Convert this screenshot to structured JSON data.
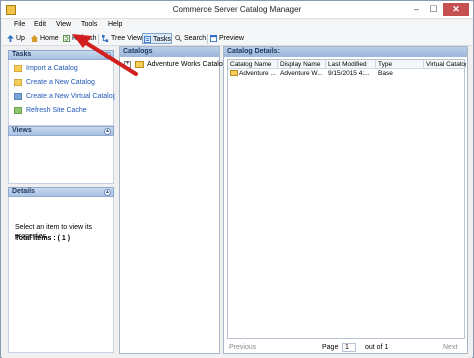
{
  "window": {
    "title": "Commerce Server Catalog Manager",
    "close_glyph": "✕",
    "min_glyph": "–",
    "max_glyph": "☐"
  },
  "menu": [
    "File",
    "Edit",
    "View",
    "Tools",
    "Help"
  ],
  "toolbar": {
    "up": "Up",
    "home": "Home",
    "refresh": "Refresh",
    "tree_view": "Tree View",
    "tasks": "Tasks",
    "search": "Search",
    "preview": "Preview"
  },
  "tasks_panel": {
    "title": "Tasks",
    "items": [
      "Import a Catalog",
      "Create a New Catalog",
      "Create a New Virtual Catalog",
      "Refresh Site Cache"
    ]
  },
  "views_panel": {
    "title": "Views"
  },
  "details_panel": {
    "title": "Details",
    "hint": "Select an item to view its properties",
    "total": "Total Items : ( 1 )"
  },
  "catalogs_pane": {
    "title": "Catalogs",
    "tree": [
      {
        "expander": "+",
        "label": "Adventure Works Catalog"
      }
    ]
  },
  "catalog_details": {
    "title": "Catalog Details:",
    "columns": [
      "Catalog Name",
      "Display Name",
      "Last Modified",
      "Type",
      "Virtual Catalog"
    ],
    "rows": [
      [
        "Adventure ...",
        "Adventure W...",
        "9/15/2015 4:...",
        "Base",
        ""
      ]
    ]
  },
  "pager": {
    "previous": "Previous",
    "page_label": "Page",
    "page_value": "1",
    "out_of": "out of 1",
    "next": "Next"
  },
  "colors": {
    "accent": "#1f58b8",
    "header": "#a9c1e3",
    "arrow": "#d11f1f"
  }
}
